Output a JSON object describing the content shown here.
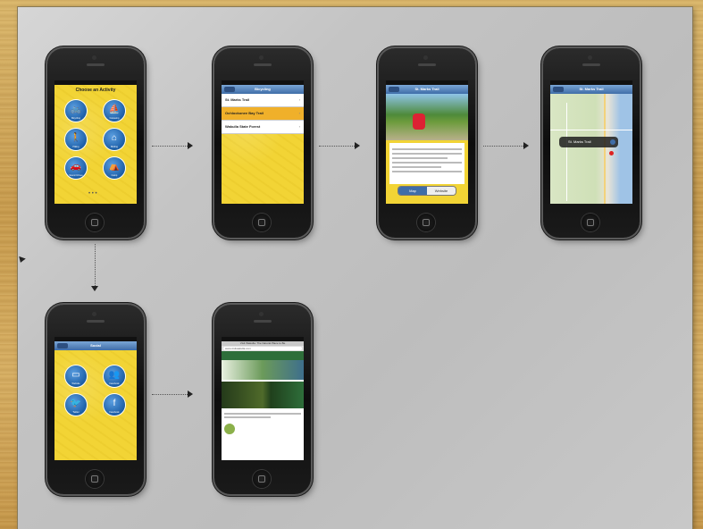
{
  "screens": {
    "activity": {
      "title": "Choose an Activity",
      "buttons": [
        "Bicycling",
        "Canoeing",
        "Hiking",
        "Birding",
        "Scenic Drives",
        "Camp"
      ]
    },
    "trails": {
      "nav_title": "Bicycling",
      "rows": [
        "St. Marks Trail",
        "Ochlockonee Bay Trail",
        "Wakulla State Forest"
      ],
      "selected_index": 1
    },
    "detail": {
      "nav_title": "St. Marks Trail",
      "tabs": [
        "Map",
        "Website"
      ]
    },
    "map": {
      "nav_title": "St. Marks Trail",
      "callout": "St. Marks Trail"
    },
    "social": {
      "nav_title": "Social",
      "buttons": [
        "Website",
        "Facebook",
        "Twitter",
        "Facebook"
      ]
    },
    "website": {
      "header_text": "Visit Wakulla: The Natural Place to Be",
      "url_text": "www.visitwakulla.com"
    }
  },
  "colors": {
    "screen_yellow": "#f2d435",
    "nav_blue": "#3f6da8",
    "selected_orange": "#f0b02a"
  }
}
